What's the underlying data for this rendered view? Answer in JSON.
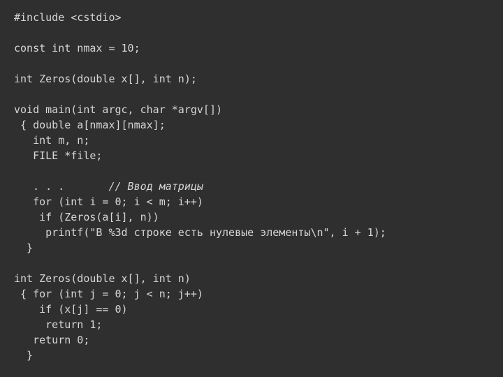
{
  "code": {
    "l01": "#include <cstdio>",
    "l02": "",
    "l03": "const int nmax = 10;",
    "l04": "",
    "l05": "int Zeros(double x[], int n);",
    "l06": "",
    "l07": "void main(int argc, char *argv[])",
    "l08": " { double a[nmax][nmax];",
    "l09": "   int m, n;",
    "l10": "   FILE *file;",
    "l11": "",
    "l12a": "   . . .       ",
    "l12b": "// Ввод матрицы",
    "l13": "   for (int i = 0; i < m; i++)",
    "l14": "    if (Zeros(a[i], n))",
    "l15": "     printf(\"В %3d строке есть нулевые элементы\\n\", i + 1);",
    "l16": "  }",
    "l17": "",
    "l18": "int Zeros(double x[], int n)",
    "l19": " { for (int j = 0; j < n; j++)",
    "l20": "    if (x[j] == 0)",
    "l21": "     return 1;",
    "l22": "   return 0;",
    "l23": "  }"
  }
}
